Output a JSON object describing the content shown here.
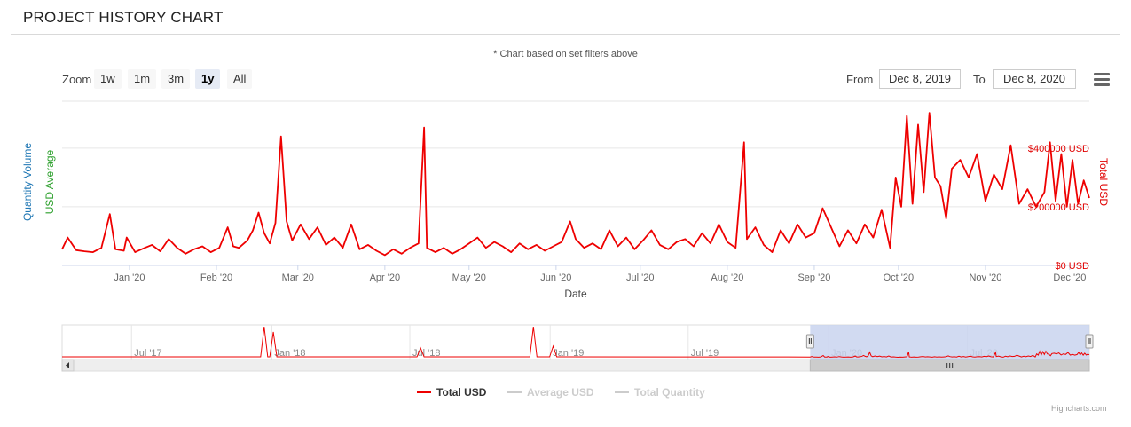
{
  "page": {
    "title": "PROJECT HISTORY CHART",
    "note": "* Chart based on set filters above"
  },
  "toolbar": {
    "zoom_label": "Zoom",
    "zoom_buttons": [
      "1w",
      "1m",
      "3m",
      "1y",
      "All"
    ],
    "active_zoom": "1y",
    "from_label": "From",
    "from_value": "Dec 8, 2019",
    "to_label": "To",
    "to_value": "Dec 8, 2020",
    "menu_icon": "hamburger-menu-icon"
  },
  "credit": "Highcharts.com",
  "colors": {
    "total_usd": "#ee0000",
    "quantity_axis": "#1f77b4",
    "usd_avg_axis": "#2ca02c",
    "navigator_mask": "#c9d3ee",
    "inactive_legend": "#cccccc"
  },
  "chart_data": {
    "type": "line",
    "xlabel": "Date",
    "y_left_labels": [
      "Quantity Volume",
      "USD Average"
    ],
    "y_right_label": "Total USD",
    "y_right_ticks": [
      "$0 USD",
      "$200000 USD",
      "$400000 USD"
    ],
    "ylim": [
      0,
      560000
    ],
    "x_ticks": [
      "Jan '20",
      "Feb '20",
      "Mar '20",
      "Apr '20",
      "May '20",
      "Jun '20",
      "Jul '20",
      "Aug '20",
      "Sep '20",
      "Oct '20",
      "Nov '20",
      "Dec '20"
    ],
    "x_start": "2019-12-08",
    "x_end": "2020-12-08",
    "legend": [
      {
        "name": "Total USD",
        "visible": true
      },
      {
        "name": "Average USD",
        "visible": false
      },
      {
        "name": "Total Quantity",
        "visible": false
      }
    ],
    "grid": true,
    "series": [
      {
        "name": "Total USD",
        "points": [
          [
            "2019-12-08",
            55000
          ],
          [
            "2019-12-10",
            95000
          ],
          [
            "2019-12-13",
            52000
          ],
          [
            "2019-12-16",
            48000
          ],
          [
            "2019-12-19",
            45000
          ],
          [
            "2019-12-22",
            60000
          ],
          [
            "2019-12-25",
            175000
          ],
          [
            "2019-12-27",
            55000
          ],
          [
            "2019-12-30",
            50000
          ],
          [
            "2019-12-31",
            95000
          ],
          [
            "2020-01-03",
            45000
          ],
          [
            "2020-01-06",
            58000
          ],
          [
            "2020-01-09",
            70000
          ],
          [
            "2020-01-12",
            48000
          ],
          [
            "2020-01-15",
            90000
          ],
          [
            "2020-01-18",
            60000
          ],
          [
            "2020-01-21",
            40000
          ],
          [
            "2020-01-24",
            55000
          ],
          [
            "2020-01-27",
            65000
          ],
          [
            "2020-01-30",
            45000
          ],
          [
            "2020-02-02",
            60000
          ],
          [
            "2020-02-05",
            130000
          ],
          [
            "2020-02-07",
            65000
          ],
          [
            "2020-02-09",
            60000
          ],
          [
            "2020-02-12",
            85000
          ],
          [
            "2020-02-14",
            120000
          ],
          [
            "2020-02-16",
            180000
          ],
          [
            "2020-02-18",
            110000
          ],
          [
            "2020-02-20",
            75000
          ],
          [
            "2020-02-22",
            145000
          ],
          [
            "2020-02-24",
            440000
          ],
          [
            "2020-02-26",
            150000
          ],
          [
            "2020-02-28",
            85000
          ],
          [
            "2020-03-02",
            140000
          ],
          [
            "2020-03-05",
            90000
          ],
          [
            "2020-03-08",
            130000
          ],
          [
            "2020-03-11",
            70000
          ],
          [
            "2020-03-14",
            95000
          ],
          [
            "2020-03-17",
            60000
          ],
          [
            "2020-03-20",
            140000
          ],
          [
            "2020-03-23",
            55000
          ],
          [
            "2020-03-26",
            70000
          ],
          [
            "2020-03-29",
            50000
          ],
          [
            "2020-04-01",
            35000
          ],
          [
            "2020-04-04",
            55000
          ],
          [
            "2020-04-07",
            40000
          ],
          [
            "2020-04-10",
            60000
          ],
          [
            "2020-04-13",
            75000
          ],
          [
            "2020-04-15",
            470000
          ],
          [
            "2020-04-16",
            60000
          ],
          [
            "2020-04-19",
            45000
          ],
          [
            "2020-04-22",
            60000
          ],
          [
            "2020-04-25",
            40000
          ],
          [
            "2020-04-28",
            55000
          ],
          [
            "2020-05-01",
            75000
          ],
          [
            "2020-05-04",
            95000
          ],
          [
            "2020-05-07",
            60000
          ],
          [
            "2020-05-10",
            80000
          ],
          [
            "2020-05-13",
            65000
          ],
          [
            "2020-05-16",
            45000
          ],
          [
            "2020-05-19",
            75000
          ],
          [
            "2020-05-22",
            55000
          ],
          [
            "2020-05-25",
            70000
          ],
          [
            "2020-05-28",
            50000
          ],
          [
            "2020-05-31",
            65000
          ],
          [
            "2020-06-03",
            80000
          ],
          [
            "2020-06-06",
            150000
          ],
          [
            "2020-06-08",
            90000
          ],
          [
            "2020-06-11",
            60000
          ],
          [
            "2020-06-14",
            75000
          ],
          [
            "2020-06-17",
            55000
          ],
          [
            "2020-06-20",
            120000
          ],
          [
            "2020-06-23",
            65000
          ],
          [
            "2020-06-26",
            95000
          ],
          [
            "2020-06-29",
            55000
          ],
          [
            "2020-07-02",
            85000
          ],
          [
            "2020-07-05",
            120000
          ],
          [
            "2020-07-08",
            70000
          ],
          [
            "2020-07-11",
            55000
          ],
          [
            "2020-07-14",
            80000
          ],
          [
            "2020-07-17",
            90000
          ],
          [
            "2020-07-20",
            65000
          ],
          [
            "2020-07-23",
            110000
          ],
          [
            "2020-07-26",
            75000
          ],
          [
            "2020-07-29",
            140000
          ],
          [
            "2020-08-01",
            80000
          ],
          [
            "2020-08-04",
            60000
          ],
          [
            "2020-08-07",
            420000
          ],
          [
            "2020-08-08",
            90000
          ],
          [
            "2020-08-11",
            130000
          ],
          [
            "2020-08-14",
            70000
          ],
          [
            "2020-08-17",
            45000
          ],
          [
            "2020-08-20",
            120000
          ],
          [
            "2020-08-23",
            75000
          ],
          [
            "2020-08-26",
            140000
          ],
          [
            "2020-08-29",
            95000
          ],
          [
            "2020-09-01",
            110000
          ],
          [
            "2020-09-04",
            195000
          ],
          [
            "2020-09-07",
            130000
          ],
          [
            "2020-09-10",
            65000
          ],
          [
            "2020-09-13",
            120000
          ],
          [
            "2020-09-16",
            75000
          ],
          [
            "2020-09-19",
            140000
          ],
          [
            "2020-09-22",
            95000
          ],
          [
            "2020-09-25",
            190000
          ],
          [
            "2020-09-28",
            60000
          ],
          [
            "2020-09-30",
            300000
          ],
          [
            "2020-10-02",
            200000
          ],
          [
            "2020-10-04",
            510000
          ],
          [
            "2020-10-06",
            210000
          ],
          [
            "2020-10-08",
            480000
          ],
          [
            "2020-10-10",
            250000
          ],
          [
            "2020-10-12",
            520000
          ],
          [
            "2020-10-14",
            300000
          ],
          [
            "2020-10-16",
            270000
          ],
          [
            "2020-10-18",
            160000
          ],
          [
            "2020-10-20",
            330000
          ],
          [
            "2020-10-23",
            360000
          ],
          [
            "2020-10-26",
            300000
          ],
          [
            "2020-10-29",
            380000
          ],
          [
            "2020-11-01",
            220000
          ],
          [
            "2020-11-04",
            310000
          ],
          [
            "2020-11-07",
            260000
          ],
          [
            "2020-11-10",
            410000
          ],
          [
            "2020-11-13",
            210000
          ],
          [
            "2020-11-16",
            260000
          ],
          [
            "2020-11-19",
            200000
          ],
          [
            "2020-11-22",
            250000
          ],
          [
            "2020-11-24",
            420000
          ],
          [
            "2020-11-26",
            220000
          ],
          [
            "2020-11-28",
            380000
          ],
          [
            "2020-11-30",
            200000
          ],
          [
            "2020-12-02",
            360000
          ],
          [
            "2020-12-04",
            210000
          ],
          [
            "2020-12-06",
            290000
          ],
          [
            "2020-12-08",
            230000
          ]
        ]
      }
    ],
    "navigator": {
      "x_ticks": [
        "Jul '17",
        "Jan '18",
        "Jul '18",
        "Jan '19",
        "Jul '19",
        "Jan '20",
        "Jul '20"
      ],
      "selected_range": [
        "Dec 8, 2019",
        "Dec 8, 2020"
      ]
    }
  }
}
